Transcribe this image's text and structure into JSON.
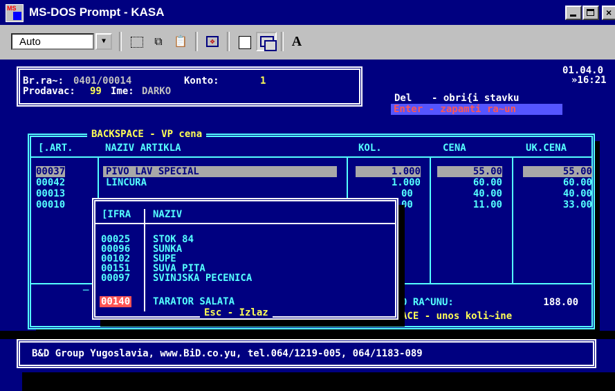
{
  "window": {
    "title": "MS-DOS Prompt - KASA",
    "icon_label": "MS"
  },
  "toolbar": {
    "font_size": "Auto",
    "bold_a": "A"
  },
  "header": {
    "bill_label": "Br.ra~:",
    "bill_value": "0401/00014",
    "konto_label": "Konto:",
    "konto_value": "1",
    "seller_label": "Prodavac:",
    "seller_id": "99",
    "name_label": "Ime:",
    "name_value": "DARKO",
    "date": "01.04.0",
    "time": "»16:21"
  },
  "hints": {
    "del_key": "Del",
    "del_text": "- obri{i stavku",
    "enter_line": "Enter - zapamti ra~un"
  },
  "items_table": {
    "title": "BACKSPACE - VP cena",
    "columns": [
      "[.ART.",
      "NAZIV ARTIKLA",
      "KOL.",
      "CENA",
      "UK.CENA"
    ],
    "rows": [
      {
        "code": "00037",
        "name": "PIVO LAV SPECIAL",
        "qty": "1.000",
        "price": "55.00",
        "total": "55.00"
      },
      {
        "code": "00042",
        "name": "LINCURA",
        "qty": "1.000",
        "price": "60.00",
        "total": "60.00"
      },
      {
        "code": "00013",
        "name": "",
        "qty": "00",
        "price": "40.00",
        "total": "40.00"
      },
      {
        "code": "00010",
        "name": "",
        "qty": "00",
        "price": "11.00",
        "total": "33.00"
      }
    ],
    "total_label": "0 RA^UNU:",
    "total_value": "188.00",
    "footer_hint": "ACE - unos koli~ine"
  },
  "popup": {
    "columns": [
      "[IFRA",
      "NAZIV"
    ],
    "rows": [
      {
        "code": "00025",
        "name": "STOK 84"
      },
      {
        "code": "00096",
        "name": "SUNKA"
      },
      {
        "code": "00102",
        "name": "SUPE"
      },
      {
        "code": "00151",
        "name": "SUVA PITA"
      },
      {
        "code": "00097",
        "name": "SVINJSKA PECENICA"
      },
      {
        "code": "00140",
        "name": "TARATOR SALATA"
      }
    ],
    "footer": "Esc - Izlaz"
  },
  "status_bar": {
    "text": "B&D Group Yugoslavia, www.BiD.co.yu, tel.064/1219-005, 064/1183-089"
  },
  "colors": {
    "dos_background": "#000080",
    "frame": "#55ffff",
    "heading": "#ffff55",
    "title_bar": "#000080"
  }
}
